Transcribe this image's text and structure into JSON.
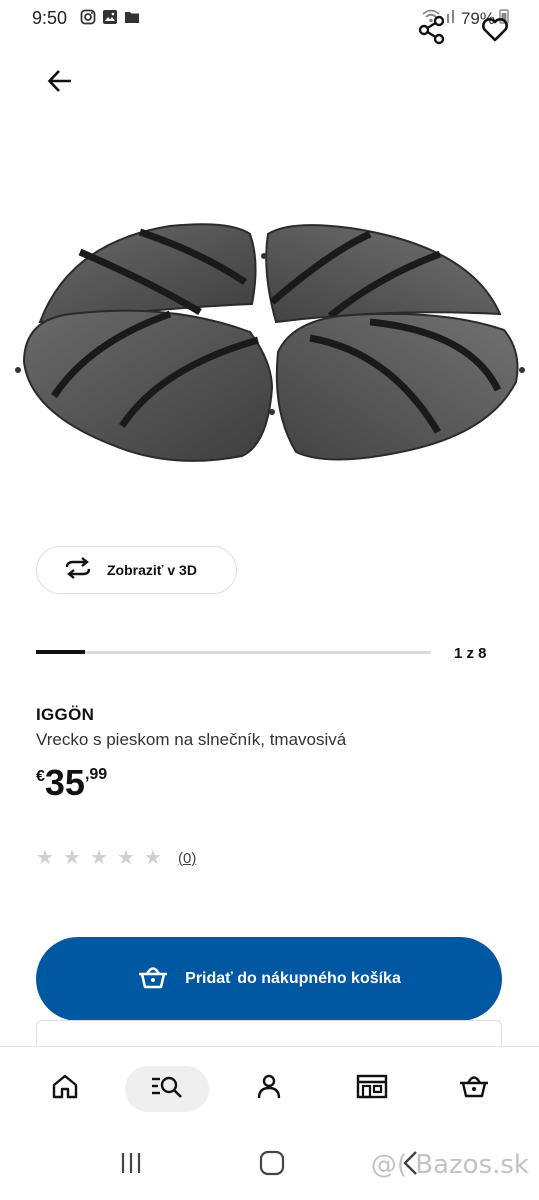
{
  "status_bar": {
    "time": "9:50",
    "battery": "79%",
    "left_icons": [
      "instagram-icon",
      "gallery-icon",
      "folder-icon"
    ],
    "right_icons": [
      "wifi-icon",
      "signal-icon",
      "battery-icon"
    ]
  },
  "header": {
    "back_icon": "arrow-left-icon",
    "share_icon": "share-icon",
    "favorite_icon": "heart-icon"
  },
  "gallery": {
    "view_3d_label": "Zobraziť v 3D",
    "counter": "1 z 8",
    "progress": 0.125
  },
  "product": {
    "name": "IGGÖN",
    "description": "Vrecko s pieskom na slnečník, tmavosivá",
    "price_currency": "€",
    "price_integer": "35",
    "price_decimal": ",99",
    "rating_stars": 5,
    "rating_filled": 0,
    "rating_count": "(0)"
  },
  "actions": {
    "add_to_cart_label": "Pridať do nákupného košíka"
  },
  "bottom_nav": {
    "items": [
      "home-icon",
      "search-icon",
      "profile-icon",
      "store-icon",
      "cart-icon"
    ],
    "active": "search-icon"
  },
  "watermark": "@( Bazos.sk",
  "colors": {
    "primary": "#0058a3",
    "text": "#111111",
    "star_empty": "#d0d0d0"
  }
}
